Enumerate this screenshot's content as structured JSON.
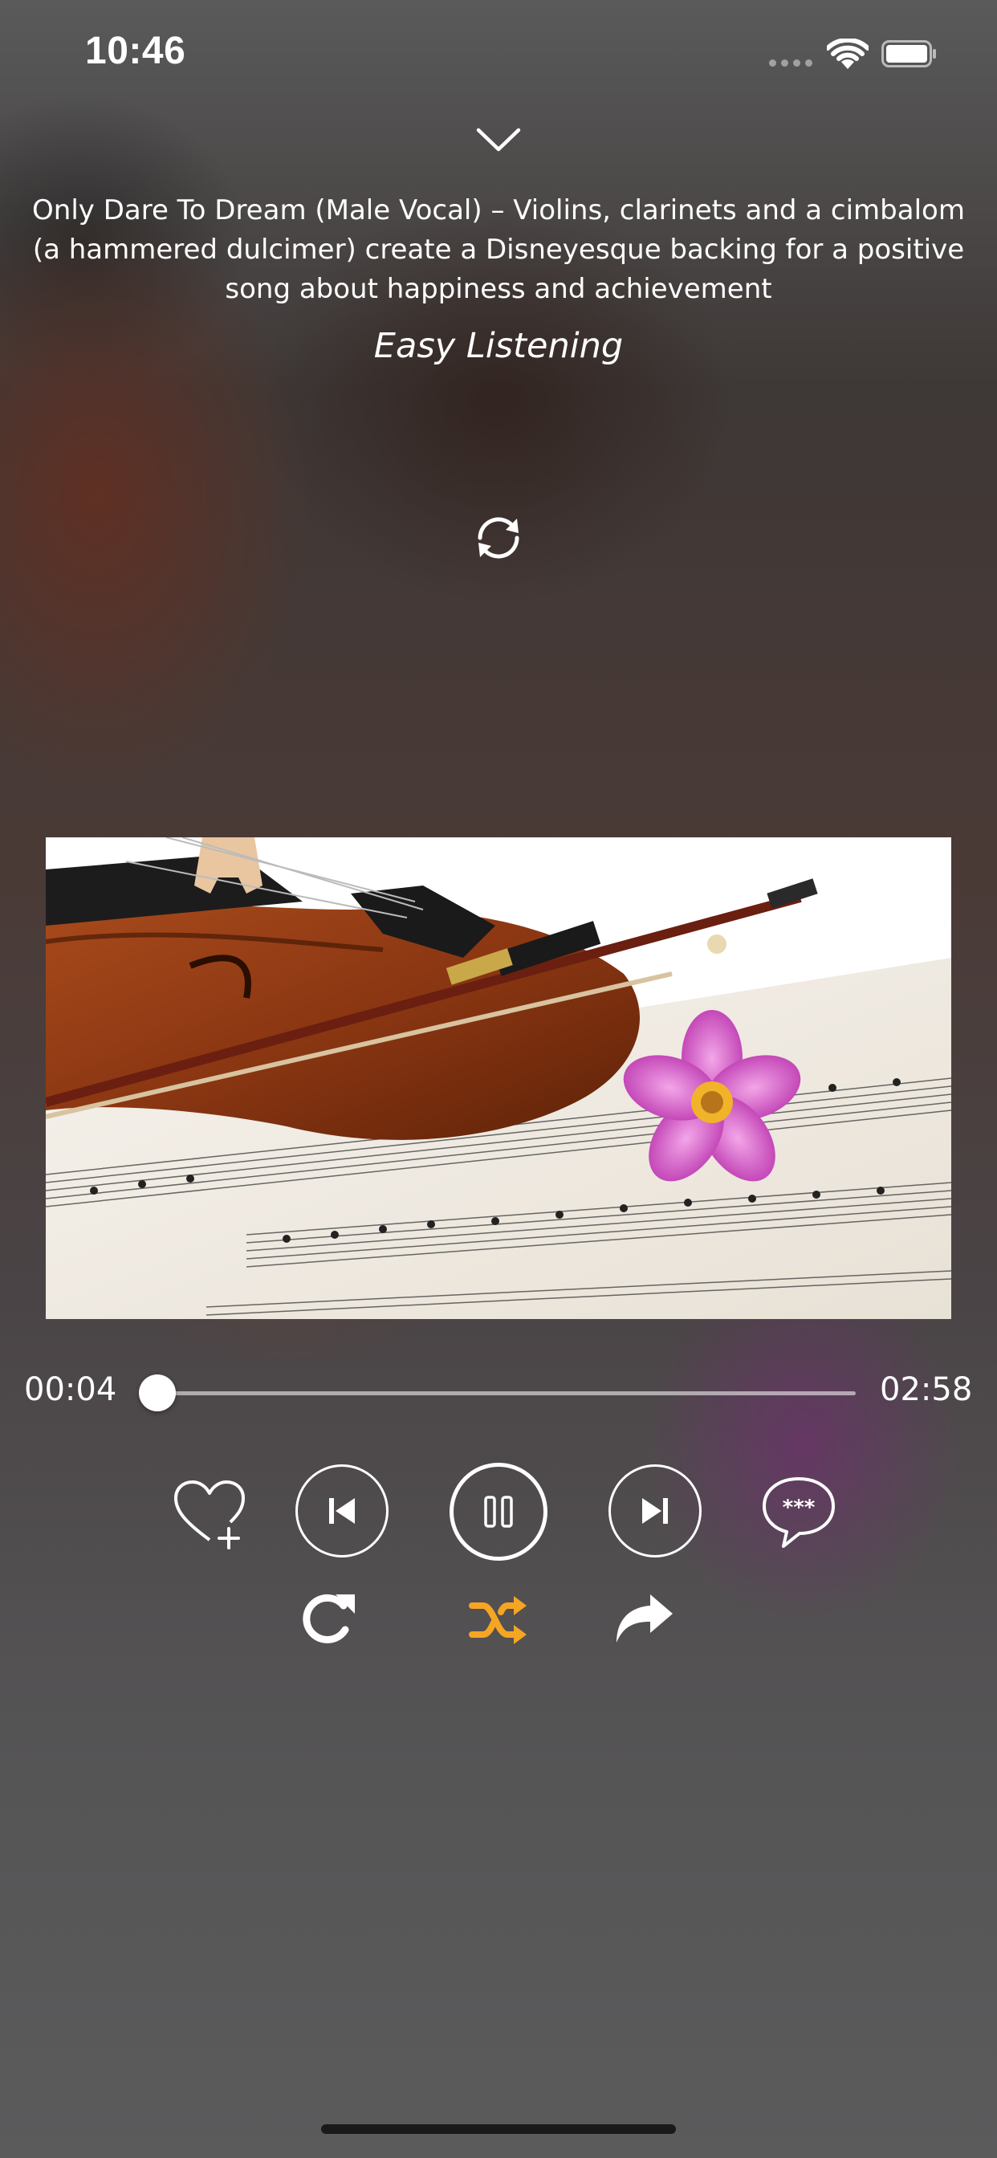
{
  "status_bar": {
    "time": "10:46",
    "icons": [
      "signal-dots-icon",
      "wifi-icon",
      "battery-icon"
    ]
  },
  "header": {
    "collapse_icon": "chevron-down-icon"
  },
  "track": {
    "description": "Only Dare To Dream (Male Vocal) – Violins, clarinets and a cimbalom (a hammered dulcimer) create a Disneyesque backing for a positive song about happiness and achievement",
    "genre": "Easy Listening",
    "artwork_subject": "violin-on-sheet-music-with-pink-flower"
  },
  "playback": {
    "elapsed": "00:04",
    "total": "02:58",
    "progress_fraction": 0.0225,
    "state": "playing"
  },
  "controls": {
    "favorite_icon": "heart-plus-icon",
    "previous_icon": "skip-previous-icon",
    "pause_icon": "pause-icon",
    "next_icon": "skip-next-icon",
    "comments_icon": "speech-bubble-stars-icon",
    "repeat_icon": "repeat-icon",
    "shuffle_icon": "shuffle-icon",
    "share_icon": "share-arrow-icon",
    "shuffle_active": true
  },
  "colors": {
    "accent": "#F5A524",
    "foreground": "#FFFFFF",
    "background": "#4A4A4B"
  }
}
